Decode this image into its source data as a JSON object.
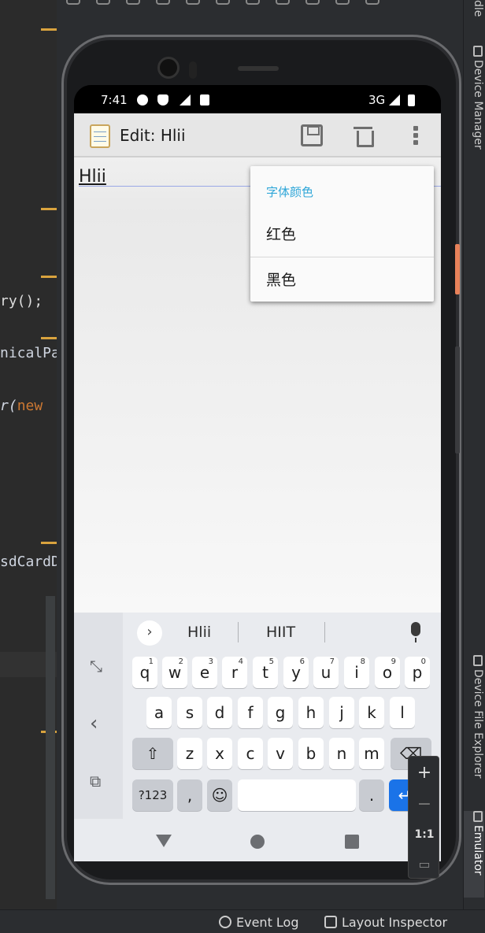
{
  "ide": {
    "code_fragments": [
      "ry();",
      "nicalPa",
      "r(",
      "new",
      "sdCardD"
    ],
    "right_tools": [
      "Device Manager",
      "Device File Explorer",
      "Emulator"
    ],
    "right_tools_top": "dle",
    "status_bar": {
      "event_log": "Event Log",
      "layout_inspector": "Layout Inspector"
    }
  },
  "device": {
    "status_bar": {
      "time": "7:41",
      "network": "3G"
    },
    "action_bar": {
      "title": "Edit: Hlii",
      "icons": [
        "notepad-icon",
        "save-icon",
        "trash-icon",
        "more-vert-icon"
      ]
    },
    "editor": {
      "text": "Hlii"
    },
    "popup_menu": {
      "header": "字体颜色",
      "items": [
        "红色",
        "黑色"
      ]
    },
    "keyboard": {
      "suggestions": [
        "Hlii",
        "HIIT"
      ],
      "row1": [
        "q",
        "w",
        "e",
        "r",
        "t",
        "y",
        "u",
        "i",
        "o",
        "p"
      ],
      "row1_hints": [
        "1",
        "2",
        "3",
        "4",
        "5",
        "6",
        "7",
        "8",
        "9",
        "0"
      ],
      "row2": [
        "a",
        "s",
        "d",
        "f",
        "g",
        "h",
        "j",
        "k",
        "l"
      ],
      "row3": [
        "z",
        "x",
        "c",
        "v",
        "b",
        "n",
        "m"
      ],
      "sym_key": "?123",
      "comma_key": ",",
      "period_key": "."
    },
    "accent_color": "#2ea6d8"
  },
  "emulator_controls": {
    "zoom_in": "+",
    "zoom_out": "−",
    "one_to_one": "1:1"
  }
}
